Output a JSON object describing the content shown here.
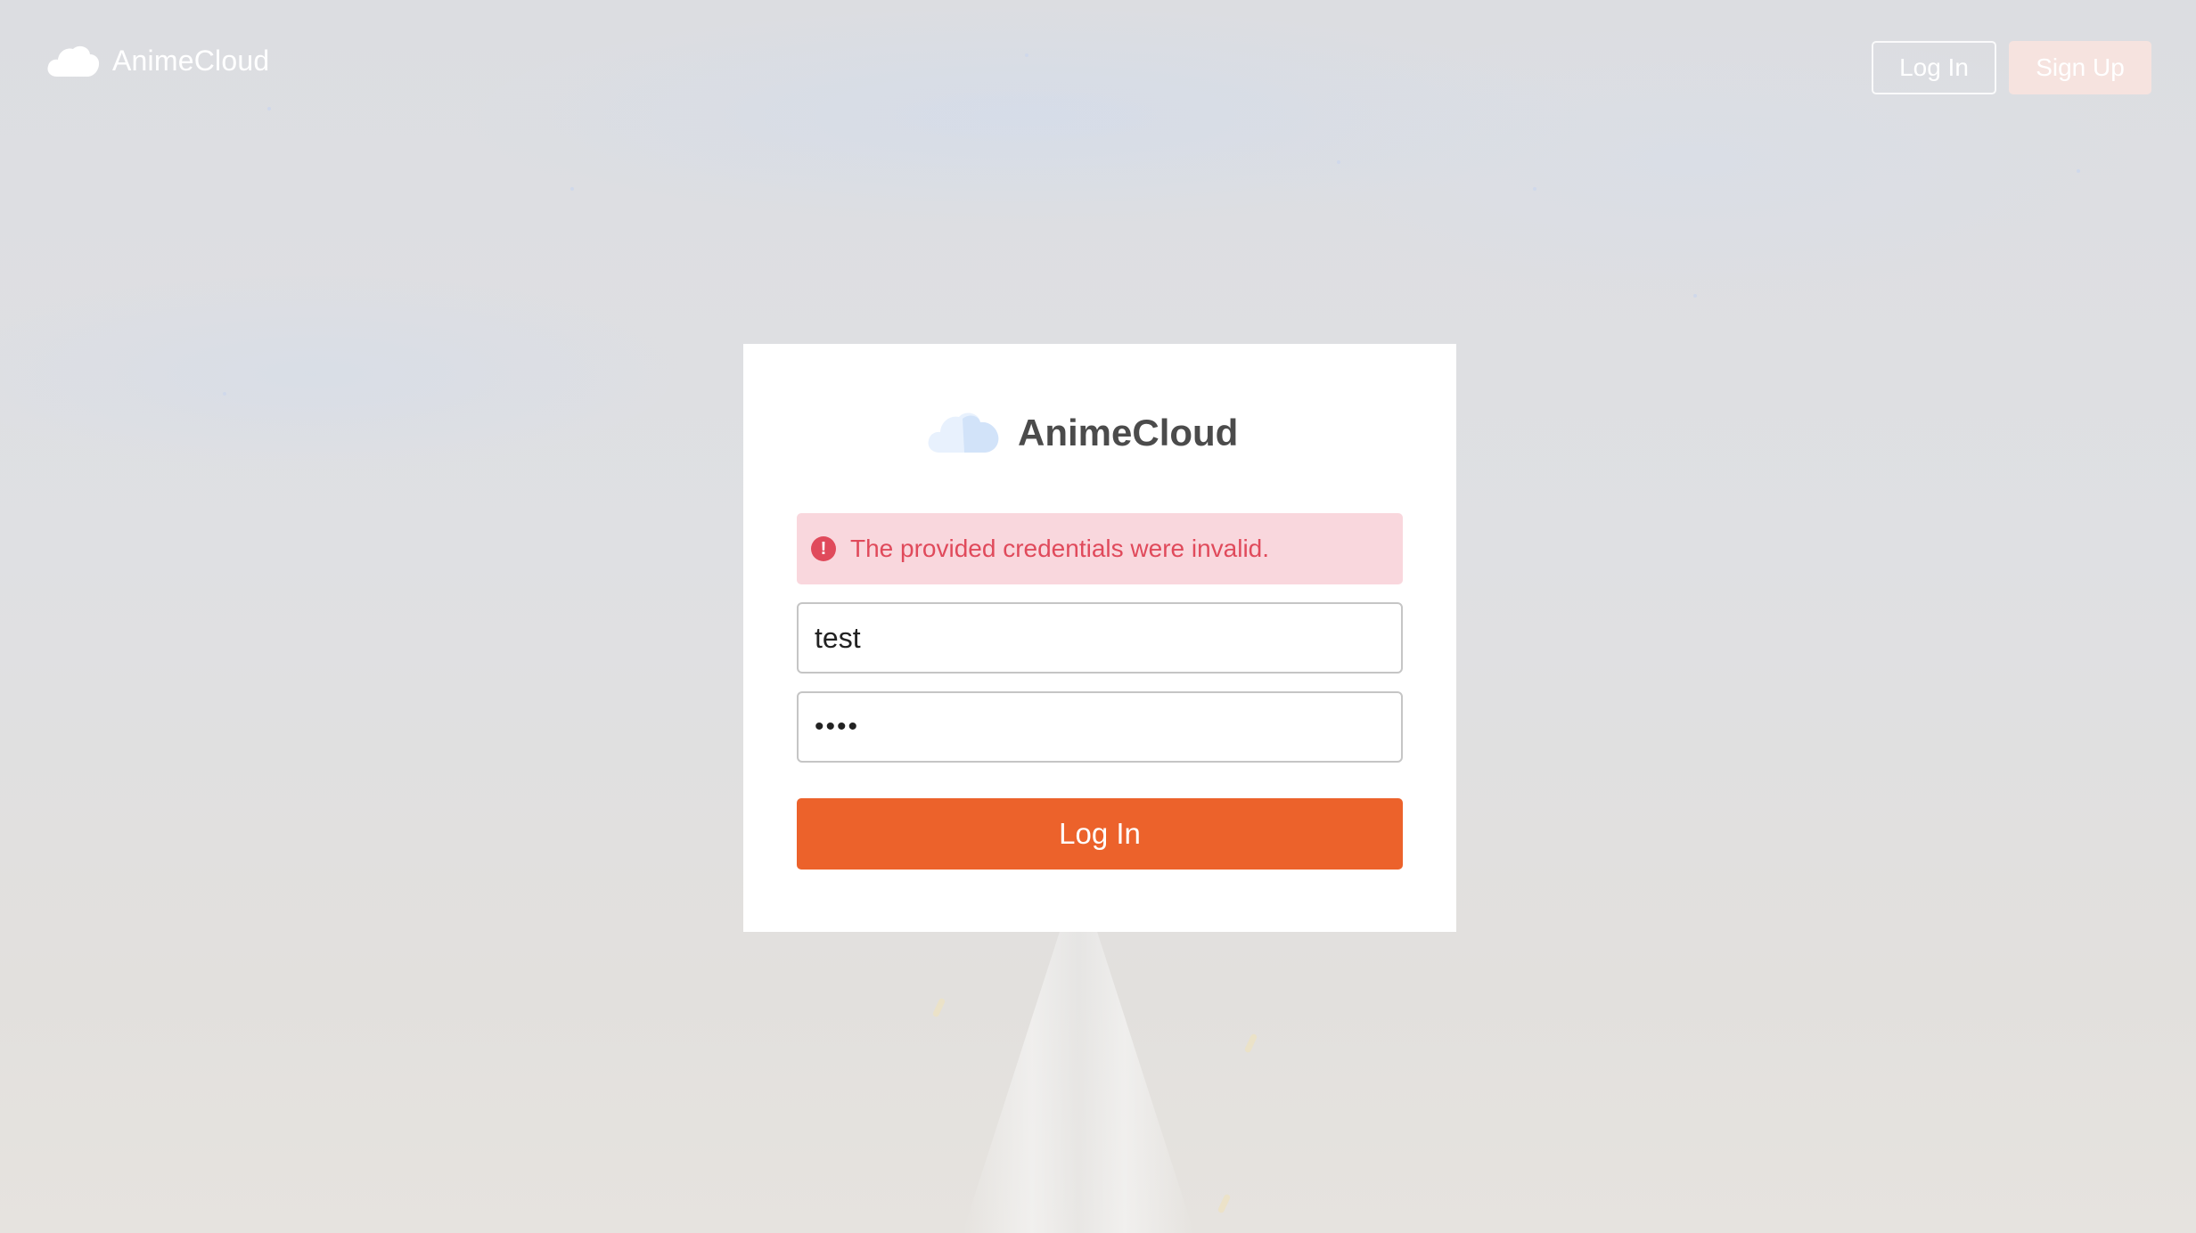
{
  "app": {
    "brand": "AnimeCloud"
  },
  "nav": {
    "login_label": "Log In",
    "signup_label": "Sign Up"
  },
  "card": {
    "brand": "AnimeCloud",
    "error_message": "The provided credentials were invalid.",
    "username_value": "test",
    "password_value": "test",
    "submit_label": "Log In"
  },
  "icons": {
    "brand_logo": "cloud-icon",
    "card_logo": "cloud-icon",
    "alert": "exclamation-circle-icon"
  },
  "colors": {
    "accent": "#ec622b",
    "error_bg": "#f9d7dd",
    "error_text": "#e04a5b",
    "signup_bg": "#f6e3df",
    "cloud_light": "#e8f1fd",
    "cloud_dark": "#d2e3f9"
  }
}
